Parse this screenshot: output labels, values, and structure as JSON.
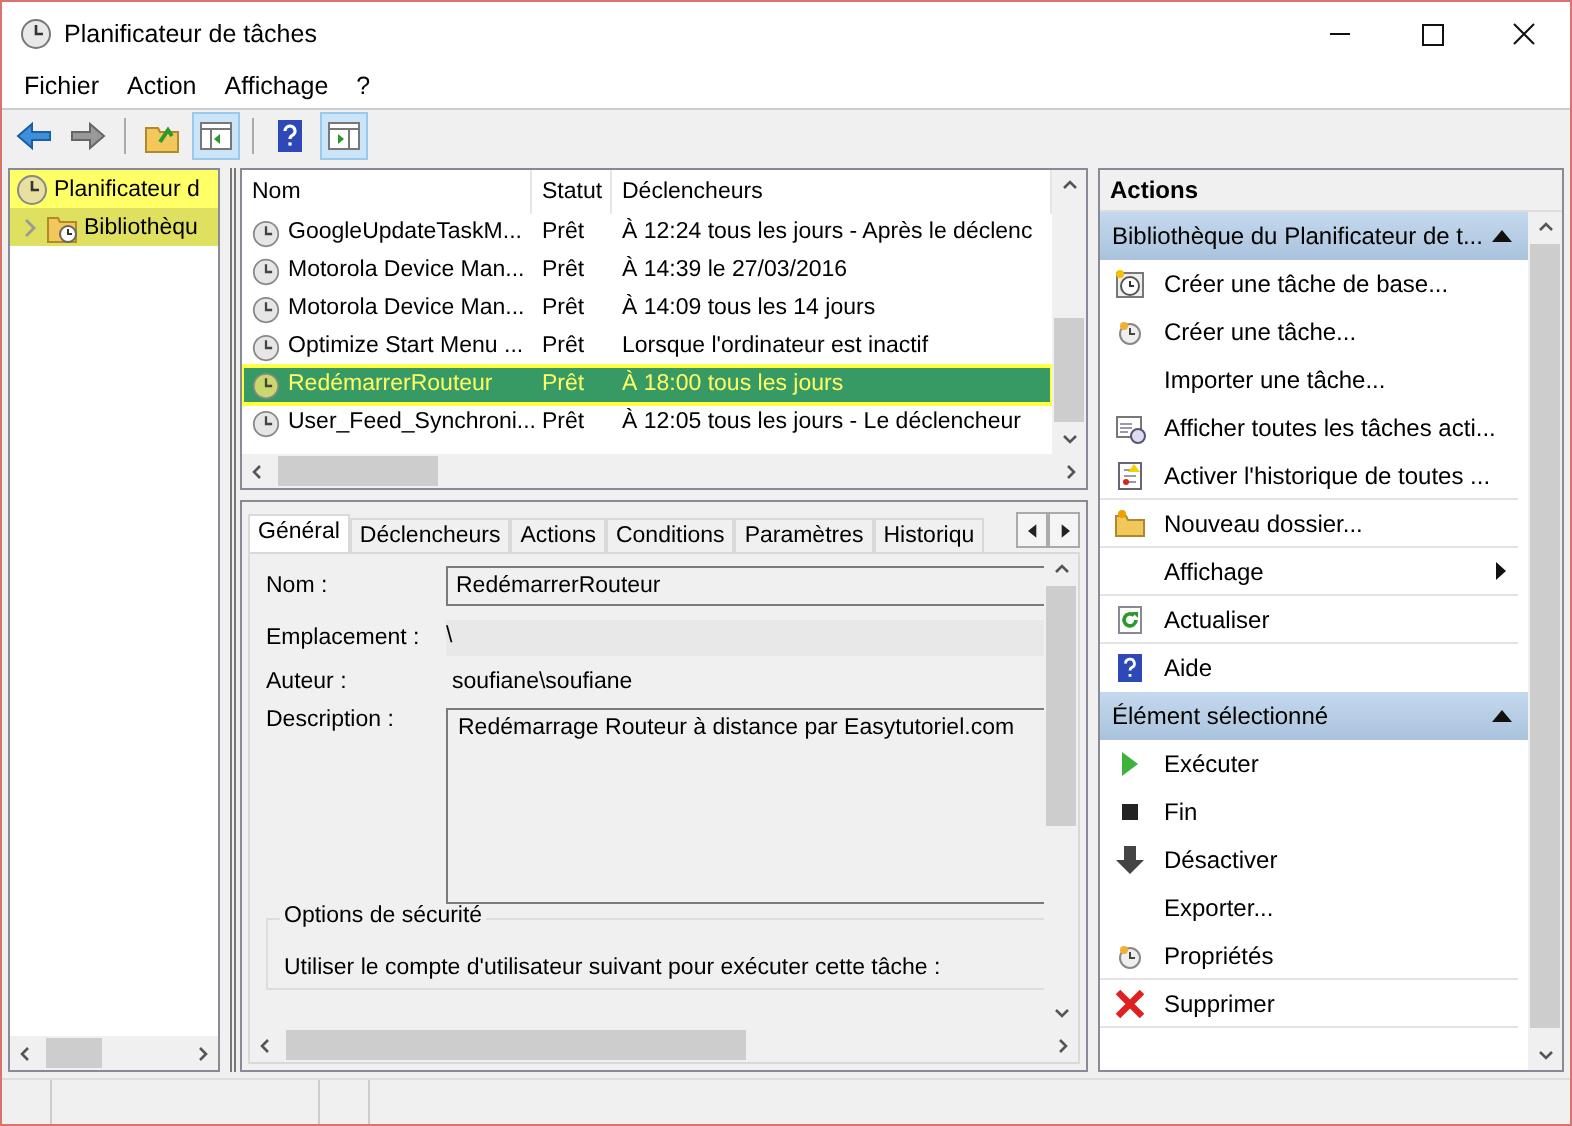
{
  "window": {
    "title": "Planificateur de tâches"
  },
  "menu": [
    "Fichier",
    "Action",
    "Affichage",
    "?"
  ],
  "tree": [
    {
      "label": "Planificateur d",
      "selected": false,
      "children": [
        {
          "label": "Bibliothèqu",
          "selected": true,
          "expanded": false
        }
      ]
    }
  ],
  "task_list": {
    "columns": [
      "Nom",
      "Statut",
      "Déclencheurs"
    ],
    "rows": [
      {
        "name": "GoogleUpdateTaskM...",
        "status": "Prêt",
        "trigger": "À 12:24 tous les jours - Après le déclenc",
        "selected": false
      },
      {
        "name": "Motorola Device Man...",
        "status": "Prêt",
        "trigger": "À 14:39 le 27/03/2016",
        "selected": false
      },
      {
        "name": "Motorola Device Man...",
        "status": "Prêt",
        "trigger": "À 14:09 tous les 14 jours",
        "selected": false
      },
      {
        "name": "Optimize Start Menu ...",
        "status": "Prêt",
        "trigger": "Lorsque l'ordinateur est inactif",
        "selected": false
      },
      {
        "name": "RedémarrerRouteur",
        "status": "Prêt",
        "trigger": "À 18:00 tous les jours",
        "selected": true
      },
      {
        "name": "User_Feed_Synchroni...",
        "status": "Prêt",
        "trigger": "À 12:05 tous les jours - Le déclencheur",
        "selected": false
      }
    ]
  },
  "detail_tabs": [
    {
      "label": "Général",
      "selected": true
    },
    {
      "label": "Déclencheurs",
      "selected": false
    },
    {
      "label": "Actions",
      "selected": false
    },
    {
      "label": "Conditions",
      "selected": false
    },
    {
      "label": "Paramètres",
      "selected": false
    },
    {
      "label": "Historiqu",
      "selected": false
    }
  ],
  "general": {
    "name_label": "Nom :",
    "name_value": "RedémarrerRouteur",
    "location_label": "Emplacement :",
    "location_value": "\\",
    "author_label": "Auteur :",
    "author_value": "soufiane\\soufiane",
    "description_label": "Description :",
    "description_value": "Redémarrage Routeur à distance par Easytutoriel.com",
    "security_title": "Options de sécurité",
    "security_text": "Utiliser le compte d'utilisateur suivant pour exécuter cette tâche :"
  },
  "actions_pane": {
    "title": "Actions",
    "sections": [
      {
        "title": "Bibliothèque du Planificateur de t...",
        "expanded": true,
        "items": [
          {
            "label": "Créer une tâche de base...",
            "kind": "basic-task",
            "submenu": false,
            "separator_after": false
          },
          {
            "label": "Créer une tâche...",
            "kind": "task",
            "submenu": false,
            "separator_after": false
          },
          {
            "label": "Importer une tâche...",
            "kind": "plain",
            "submenu": false,
            "separator_after": false
          },
          {
            "label": "Afficher toutes les tâches acti...",
            "kind": "list",
            "submenu": false,
            "separator_after": false
          },
          {
            "label": "Activer l'historique de toutes ...",
            "kind": "history",
            "submenu": false,
            "separator_after": true
          },
          {
            "label": "Nouveau dossier...",
            "kind": "folder",
            "submenu": false,
            "separator_after": true
          },
          {
            "label": "Affichage",
            "kind": "plain",
            "submenu": true,
            "separator_after": true
          },
          {
            "label": "Actualiser",
            "kind": "refresh",
            "submenu": false,
            "separator_after": true
          },
          {
            "label": "Aide",
            "kind": "help",
            "submenu": false,
            "separator_after": false
          }
        ]
      },
      {
        "title": "Élément sélectionné",
        "expanded": true,
        "items": [
          {
            "label": "Exécuter",
            "kind": "run",
            "submenu": false,
            "separator_after": false
          },
          {
            "label": "Fin",
            "kind": "end",
            "submenu": false,
            "separator_after": false
          },
          {
            "label": "Désactiver",
            "kind": "disable",
            "submenu": false,
            "separator_after": false
          },
          {
            "label": "Exporter...",
            "kind": "plain",
            "submenu": false,
            "separator_after": false
          },
          {
            "label": "Propriétés",
            "kind": "task",
            "submenu": false,
            "separator_after": true
          },
          {
            "label": "Supprimer",
            "kind": "delete",
            "submenu": false,
            "separator_after": true
          }
        ]
      }
    ]
  }
}
